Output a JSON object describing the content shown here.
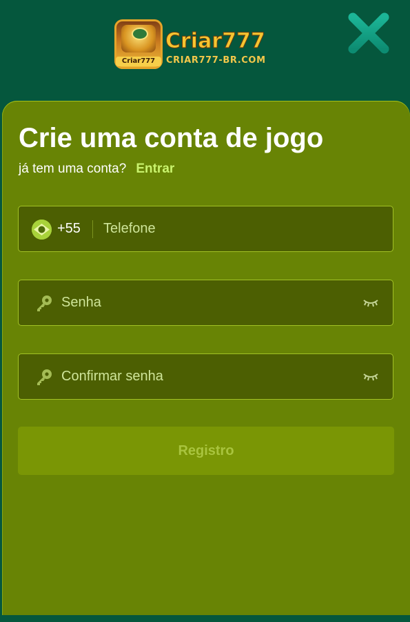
{
  "header": {
    "logo_badge_text": "Criar777",
    "brand_name": "Criar777",
    "brand_domain": "CRIAR777-BR.COM"
  },
  "form": {
    "title": "Crie uma conta de jogo",
    "subtitle": "já tem uma conta?",
    "login_link": "Entrar",
    "phone": {
      "country_code": "+55",
      "placeholder": "Telefone"
    },
    "password": {
      "placeholder": "Senha"
    },
    "confirm_password": {
      "placeholder": "Confirmar senha"
    },
    "register_label": "Registro"
  },
  "colors": {
    "header_bg": "#05573d",
    "card_bg": "#688405",
    "input_bg": "#4c5f02",
    "input_border": "#a2c225",
    "link_accent": "#c9f36d",
    "button_bg": "#7a9605",
    "close_icon": "#1aa58a"
  }
}
